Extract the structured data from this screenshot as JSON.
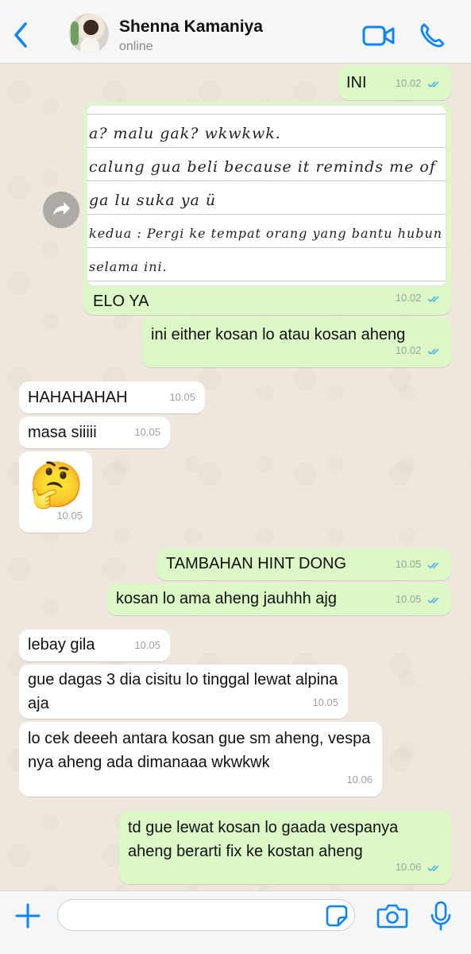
{
  "header": {
    "contact_name": "Shenna Kamaniya",
    "status": "online"
  },
  "messages": [
    {
      "id": "m1",
      "side": "out",
      "text": "INI",
      "time": "10.02",
      "read": true
    },
    {
      "id": "m2",
      "side": "out",
      "type": "image",
      "caption": "ELO YA",
      "time": "10.02",
      "read": true,
      "image_text": [
        "a? malu gak? wkwkwk.",
        "calung gua beli because it reminds me of",
        "ga lu suka ya ü",
        "kedua : Pergi ke tempat orang yang bantu hubun",
        "selama ini."
      ]
    },
    {
      "id": "m3",
      "side": "out",
      "text": "ini either kosan lo atau kosan aheng",
      "time": "10.02",
      "read": true
    },
    {
      "id": "m4",
      "side": "in",
      "text": "HAHAHAHAH",
      "time": "10.05"
    },
    {
      "id": "m5",
      "side": "in",
      "text": "masa siiiii",
      "time": "10.05"
    },
    {
      "id": "m6",
      "side": "in",
      "text": "🤔",
      "time": "10.05"
    },
    {
      "id": "m7",
      "side": "out",
      "text": "TAMBAHAN HINT DONG",
      "time": "10.05",
      "read": true
    },
    {
      "id": "m8",
      "side": "out",
      "text": "kosan lo ama aheng jauhhh ajg",
      "time": "10.05",
      "read": true
    },
    {
      "id": "m9",
      "side": "in",
      "text": "lebay gila",
      "time": "10.05"
    },
    {
      "id": "m10",
      "side": "in",
      "text": "gue dagas 3 dia cisitu lo tinggal lewat alpina aja",
      "time": "10.05"
    },
    {
      "id": "m11",
      "side": "in",
      "text": "lo cek deeeh antara kosan gue sm aheng, vespa nya aheng ada dimanaaa wkwkwk",
      "time": "10.06"
    },
    {
      "id": "m12",
      "side": "out",
      "text": "td gue lewat kosan lo gaada vespanya aheng berarti fix ke kostan aheng",
      "time": "10.06",
      "read": true
    }
  ],
  "icons": {
    "back": "chevron-left-icon",
    "video": "video-camera-icon",
    "call": "phone-icon",
    "forward": "forward-arrow-icon",
    "plus": "plus-icon",
    "sticker": "sticker-icon",
    "camera": "camera-icon",
    "mic": "microphone-icon",
    "read_receipt": "double-check-icon"
  },
  "colors": {
    "accent": "#0a84ff",
    "outgoing_bubble": "#dcf8c6",
    "incoming_bubble": "#ffffff",
    "chat_background": "#efe7de",
    "read_ticks": "#4fb6ec"
  },
  "composer": {
    "placeholder": ""
  }
}
